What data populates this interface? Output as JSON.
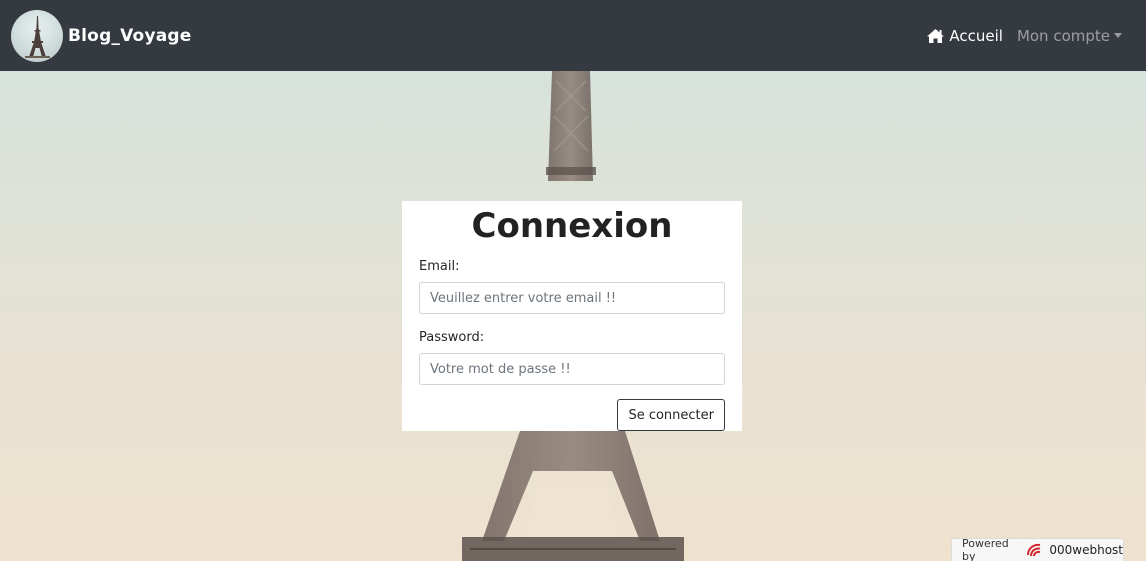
{
  "brand": {
    "name": "Blog_Voyage"
  },
  "nav": {
    "home_label": "Accueil",
    "account_label": "Mon compte"
  },
  "login": {
    "title": "Connexion",
    "email_label": "Email:",
    "email_placeholder": "Veuillez entrer votre email !!",
    "password_label": "Password:",
    "password_placeholder": "Votre mot de passe !!",
    "submit_label": "Se connecter"
  },
  "footer_badge": {
    "prefix": "Powered by",
    "host": "000webhost"
  },
  "colors": {
    "navbar": "#343a40",
    "accent_host": "#d3242f"
  },
  "icons": {
    "home": "home-icon",
    "caret": "chevron-down-icon",
    "host_logo": "000webhost-logo-icon"
  }
}
